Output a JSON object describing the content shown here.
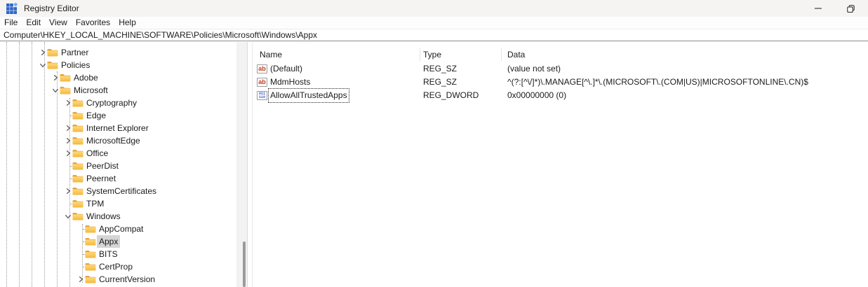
{
  "window": {
    "title": "Registry Editor",
    "icon": "registry-editor-icon",
    "controls": [
      {
        "name": "minimize-button",
        "icon": "minimize-icon"
      },
      {
        "name": "restore-button",
        "icon": "restore-icon"
      }
    ]
  },
  "menu": {
    "items": [
      "File",
      "Edit",
      "View",
      "Favorites",
      "Help"
    ]
  },
  "address_bar": {
    "value": "Computer\\HKEY_LOCAL_MACHINE\\SOFTWARE\\Policies\\Microsoft\\Windows\\Appx"
  },
  "tree": {
    "item_icon": "folder-icon",
    "items": [
      {
        "label": "Partner",
        "depth": 3,
        "state": "collapsed",
        "selected": false
      },
      {
        "label": "Policies",
        "depth": 3,
        "state": "expanded",
        "selected": false
      },
      {
        "label": "Adobe",
        "depth": 4,
        "state": "collapsed",
        "selected": false
      },
      {
        "label": "Microsoft",
        "depth": 4,
        "state": "expanded",
        "selected": false
      },
      {
        "label": "Cryptography",
        "depth": 5,
        "state": "collapsed",
        "selected": false
      },
      {
        "label": "Edge",
        "depth": 5,
        "state": "leaf",
        "selected": false
      },
      {
        "label": "Internet Explorer",
        "depth": 5,
        "state": "collapsed",
        "selected": false
      },
      {
        "label": "MicrosoftEdge",
        "depth": 5,
        "state": "collapsed",
        "selected": false
      },
      {
        "label": "Office",
        "depth": 5,
        "state": "collapsed",
        "selected": false
      },
      {
        "label": "PeerDist",
        "depth": 5,
        "state": "leaf",
        "selected": false
      },
      {
        "label": "Peernet",
        "depth": 5,
        "state": "leaf",
        "selected": false
      },
      {
        "label": "SystemCertificates",
        "depth": 5,
        "state": "collapsed",
        "selected": false
      },
      {
        "label": "TPM",
        "depth": 5,
        "state": "leaf",
        "selected": false
      },
      {
        "label": "Windows",
        "depth": 5,
        "state": "expanded",
        "selected": false
      },
      {
        "label": "AppCompat",
        "depth": 6,
        "state": "leaf",
        "selected": false
      },
      {
        "label": "Appx",
        "depth": 6,
        "state": "leaf",
        "selected": true
      },
      {
        "label": "BITS",
        "depth": 6,
        "state": "leaf",
        "selected": false
      },
      {
        "label": "CertProp",
        "depth": 6,
        "state": "leaf",
        "selected": false
      },
      {
        "label": "CurrentVersion",
        "depth": 6,
        "state": "collapsed",
        "selected": false
      }
    ]
  },
  "list": {
    "columns": [
      "Name",
      "Type",
      "Data"
    ],
    "rows": [
      {
        "icon": "string-value-icon",
        "name": "(Default)",
        "type": "REG_SZ",
        "data": "(value not set)",
        "focused": false
      },
      {
        "icon": "string-value-icon",
        "name": "MdmHosts",
        "type": "REG_SZ",
        "data": "^(?:[^\\/]*)\\.MANAGE[^\\.]*\\.(MICROSOFT\\.(COM|US)|MICROSOFTONLINE\\.CN)$",
        "focused": false
      },
      {
        "icon": "dword-value-icon",
        "name": "AllowAllTrustedApps",
        "type": "REG_DWORD",
        "data": "0x00000000 (0)",
        "focused": true
      }
    ]
  },
  "colors": {
    "titlebar": "#f5f4f3",
    "selection": "#d5d5d5",
    "folder_front_top": "#FFDA79",
    "folder_front_bottom": "#F4B73F",
    "folder_back": "#E8A33D",
    "string_icon_text": "#C8371F",
    "dword_icon_text": "#3B55C8",
    "registry_icon_blue": "#2E66C9",
    "registry_icon_light": "#6CB2F0"
  }
}
